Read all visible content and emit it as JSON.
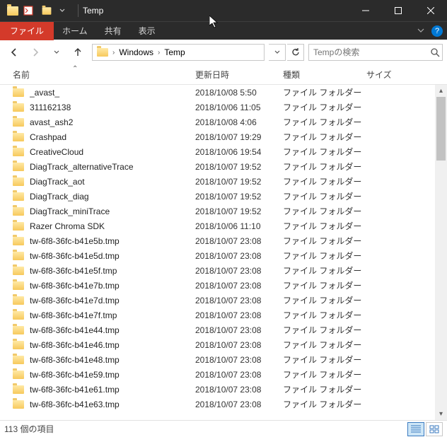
{
  "window": {
    "title": "Temp"
  },
  "menubar": {
    "file": "ファイル",
    "home": "ホーム",
    "share": "共有",
    "view": "表示"
  },
  "breadcrumbs": [
    "Windows",
    "Temp"
  ],
  "search": {
    "placeholder": "Tempの検索"
  },
  "columns": {
    "name": "名前",
    "date": "更新日時",
    "type": "種類",
    "size": "サイズ"
  },
  "type_label": "ファイル フォルダー",
  "files": [
    {
      "name": "_avast_",
      "date": "2018/10/08 5:50"
    },
    {
      "name": "311162138",
      "date": "2018/10/06 11:05"
    },
    {
      "name": "avast_ash2",
      "date": "2018/10/08 4:06"
    },
    {
      "name": "Crashpad",
      "date": "2018/10/07 19:29"
    },
    {
      "name": "CreativeCloud",
      "date": "2018/10/06 19:54"
    },
    {
      "name": "DiagTrack_alternativeTrace",
      "date": "2018/10/07 19:52"
    },
    {
      "name": "DiagTrack_aot",
      "date": "2018/10/07 19:52"
    },
    {
      "name": "DiagTrack_diag",
      "date": "2018/10/07 19:52"
    },
    {
      "name": "DiagTrack_miniTrace",
      "date": "2018/10/07 19:52"
    },
    {
      "name": "Razer Chroma SDK",
      "date": "2018/10/06 11:10"
    },
    {
      "name": "tw-6f8-36fc-b41e5b.tmp",
      "date": "2018/10/07 23:08"
    },
    {
      "name": "tw-6f8-36fc-b41e5d.tmp",
      "date": "2018/10/07 23:08"
    },
    {
      "name": "tw-6f8-36fc-b41e5f.tmp",
      "date": "2018/10/07 23:08"
    },
    {
      "name": "tw-6f8-36fc-b41e7b.tmp",
      "date": "2018/10/07 23:08"
    },
    {
      "name": "tw-6f8-36fc-b41e7d.tmp",
      "date": "2018/10/07 23:08"
    },
    {
      "name": "tw-6f8-36fc-b41e7f.tmp",
      "date": "2018/10/07 23:08"
    },
    {
      "name": "tw-6f8-36fc-b41e44.tmp",
      "date": "2018/10/07 23:08"
    },
    {
      "name": "tw-6f8-36fc-b41e46.tmp",
      "date": "2018/10/07 23:08"
    },
    {
      "name": "tw-6f8-36fc-b41e48.tmp",
      "date": "2018/10/07 23:08"
    },
    {
      "name": "tw-6f8-36fc-b41e59.tmp",
      "date": "2018/10/07 23:08"
    },
    {
      "name": "tw-6f8-36fc-b41e61.tmp",
      "date": "2018/10/07 23:08"
    },
    {
      "name": "tw-6f8-36fc-b41e63.tmp",
      "date": "2018/10/07 23:08"
    }
  ],
  "status": {
    "items": "113 個の項目"
  }
}
